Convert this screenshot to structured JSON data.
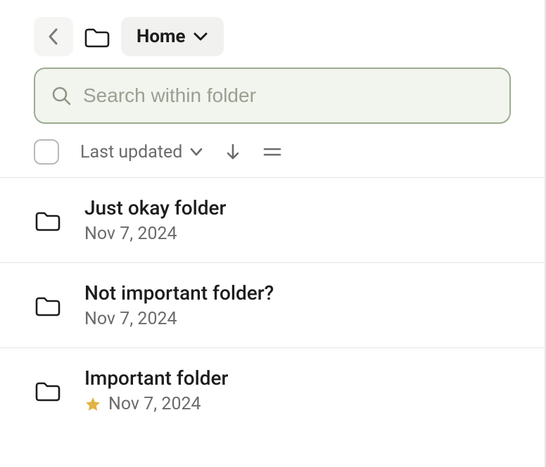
{
  "header": {
    "breadcrumb_label": "Home"
  },
  "search": {
    "placeholder": "Search within folder"
  },
  "toolbar": {
    "sort_label": "Last updated"
  },
  "items": [
    {
      "name": "Just okay folder",
      "date": "Nov 7, 2024",
      "starred": false
    },
    {
      "name": "Not important folder?",
      "date": "Nov 7, 2024",
      "starred": false
    },
    {
      "name": "Important folder",
      "date": "Nov 7, 2024",
      "starred": true
    }
  ]
}
